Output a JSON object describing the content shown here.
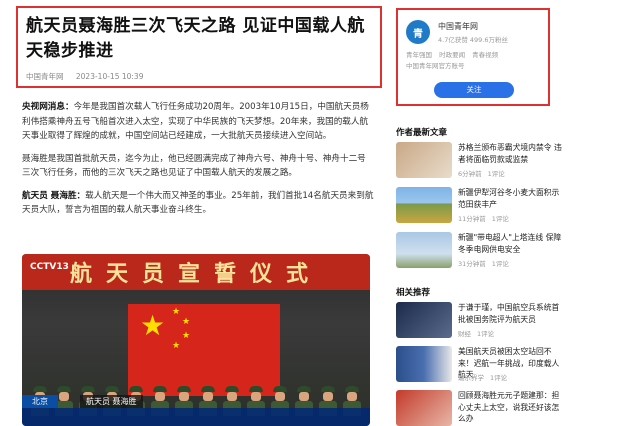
{
  "article": {
    "title": "航天员聂海胜三次飞天之路 见证中国载人航天稳步推进",
    "source": "中国青年网",
    "date": "2023-10-15 10:39",
    "p1_lead": "央视网消息：",
    "p1_body": "今年是我国首次载人飞行任务成功20周年。2003年10月15日，中国航天员杨利伟搭乘神舟五号飞船首次进入太空，实现了中华民族的飞天梦想。20年来，我国的载人航天事业取得了辉煌的成就，中国空间站已经建成，一大批航天员接续进入空间站。",
    "p2": "聂海胜是我国首批航天员，迄今为止，他已经圆满完成了神舟六号、神舟十号、神舟十二号三次飞行任务，而他的三次飞天之路也见证了中国载人航天的发展之路。",
    "p3_lead": "航天员 聂海胜：",
    "p3_body": "载人航天是一个伟大而又神圣的事业。25年前，我们首批14名航天员来到航天员大队，誓言为祖国的载人航天事业奋斗终生。"
  },
  "video": {
    "banner": "航天员宣誓仪式",
    "channel": "CCTV13",
    "location": "北京",
    "reporter": "航天员 聂海胜"
  },
  "account": {
    "name": "中国青年网",
    "logo_text": "青",
    "stats": "4.7亿获赞 499.6万粉丝",
    "tags": [
      "青年强国",
      "时政要闻",
      "青春视频",
      "中国青年网官方账号"
    ],
    "follow": "关注"
  },
  "recent": {
    "title": "作者最新文章",
    "items": [
      {
        "text": "苏格兰颁布恶霸犬境内禁令 违者将面临罚款或监禁",
        "time": "6分钟前",
        "comments": "1评论"
      },
      {
        "text": "新疆伊犁河谷冬小麦大面积示范田获丰产",
        "time": "11分钟前",
        "comments": "1评论"
      },
      {
        "text": "新疆\"带电超人\"上塔连线 保障冬季电网供电安全",
        "time": "31分钟前",
        "comments": "1评论"
      }
    ]
  },
  "related": {
    "title": "相关推荐",
    "items": [
      {
        "text": "于谦于瑾，中国航空兵系统首批被国务院评为航天员",
        "source": "财经",
        "comments": "1评论"
      },
      {
        "text": "美国航天员被困太空站回不来！迟航一年挑战，印度载人航天",
        "source": "瑞示界学",
        "comments": "1评论"
      },
      {
        "text": "回顾聂海胜元元子题建那：担心丈夫上太空，说我还好该怎么办",
        "source": "",
        "comments": ""
      }
    ]
  }
}
